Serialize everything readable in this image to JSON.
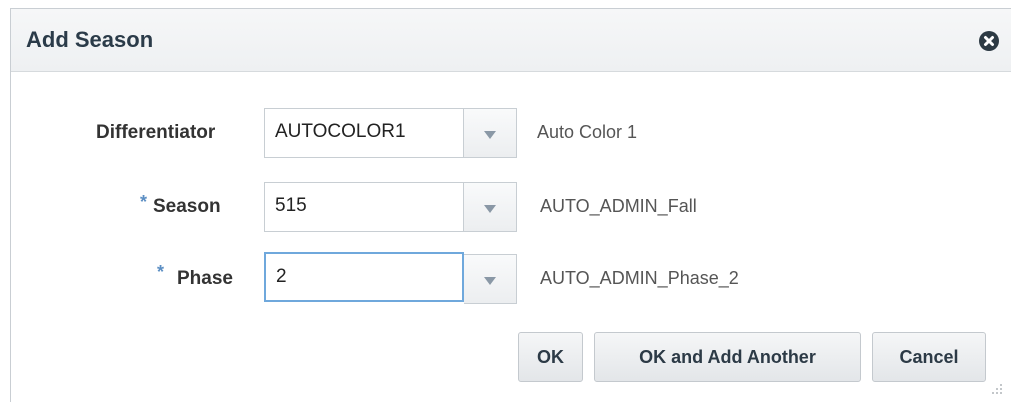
{
  "dialog": {
    "title": "Add Season",
    "close_icon": "close-circle-icon"
  },
  "form": {
    "differentiator": {
      "label": "Differentiator",
      "value": "AUTOCOLOR1",
      "description": "Auto Color 1",
      "required": false
    },
    "season": {
      "label": "Season",
      "value": "515",
      "description": "AUTO_ADMIN_Fall",
      "required": true
    },
    "phase": {
      "label": "Phase",
      "value": "2",
      "description": "AUTO_ADMIN_Phase_2",
      "required": true
    },
    "required_marker": "*"
  },
  "buttons": {
    "ok": "OK",
    "ok_add_another": "OK and Add Another",
    "cancel": "Cancel"
  },
  "colors": {
    "title_text": "#2b3b49",
    "required_marker": "#5b8ec3",
    "focus_border": "#6fa8dc"
  }
}
